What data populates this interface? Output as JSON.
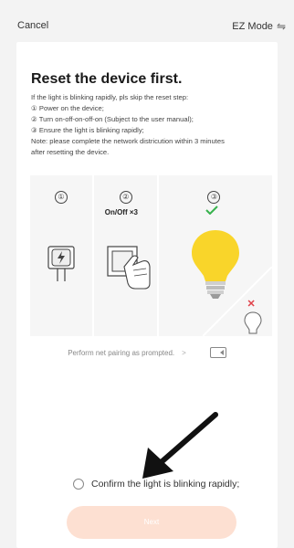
{
  "header": {
    "cancel_label": "Cancel",
    "mode_label": "EZ Mode",
    "mode_icon": "swap-icon"
  },
  "card": {
    "title": "Reset the device first.",
    "lines": [
      "If the light is blinking rapidly, pls skip the reset step:",
      "① Power on the device;",
      "② Turn on-off-on-off-on (Subject to the user manual);",
      "③ Ensure the light is blinking rapidly;",
      "Note: please complete the network districution within 3 minutes",
      "after resetting the device."
    ],
    "steps": [
      {
        "number": "①",
        "icon": "power-plug-icon"
      },
      {
        "number": "②",
        "caption": "On/Off ×3",
        "icon": "switch-press-icon"
      },
      {
        "number": "③",
        "icon": "lightbulb-icon",
        "status": "check"
      }
    ],
    "pairing_text": "Perform net pairing as prompted.",
    "pairing_chevron": ">",
    "video_icon": "video-icon",
    "confirm_label": "Confirm the light is blinking rapidly;",
    "next_label": "Next"
  },
  "colors": {
    "bulb": "#f9d52a",
    "check": "#37b24d",
    "cross": "#e0424a",
    "next_button": "#fde0d2"
  }
}
